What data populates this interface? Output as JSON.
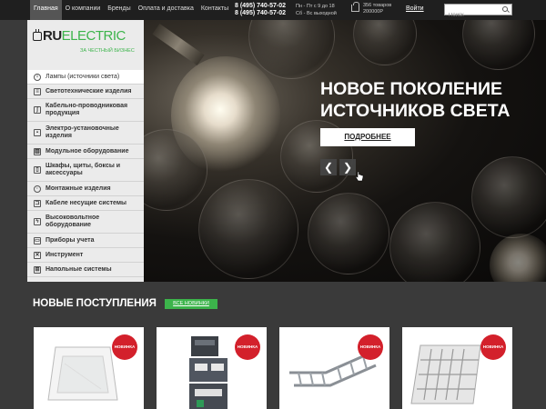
{
  "topbar": {
    "nav": [
      "Главная",
      "О компании",
      "Бренды",
      "Оплата и доставка",
      "Контакты"
    ],
    "phones": [
      "8 (495) 740-57-02",
      "8 (495) 740-57-02"
    ],
    "hours": [
      "Пн - Пт с 9 до 18",
      "Сб - Вс выходной"
    ],
    "cart": [
      "356 товаров",
      "200000Р"
    ],
    "login": "Войти",
    "search_placeholder": "Поиск"
  },
  "logo": {
    "ru": "RU",
    "electric": "ELECTRIC",
    "tagline": "ЗА ЧЕСТНЫЙ БИЗНЕС"
  },
  "categories": [
    "Лампы (источники света)",
    "Светотехнические изделия",
    "Кабельно-проводниковая продукция",
    "Электро-установочные изделия",
    "Модульное оборудование",
    "Шкафы, щиты, боксы и аксессуары",
    "Монтажные изделия",
    "Кабеле несущие системы",
    "Высоковольтное оборудование",
    "Приборы учета",
    "Инструмент",
    "Напольные системы"
  ],
  "hero": {
    "title": "НОВОЕ ПОКОЛЕНИЕ ИСТОЧНИКОВ СВЕТА",
    "button": "ПОДРОБНЕЕ",
    "prev": "❮",
    "next": "❯"
  },
  "new_arrivals": {
    "title": "НОВЫЕ ПОСТУПЛЕНИЯ",
    "all_button": "ВСЕ НОВИНКИ",
    "badge": "НОВИНКА"
  },
  "colors": {
    "accent_green": "#3cb44b",
    "badge_red": "#d3202b",
    "topbar": "#1f1f1f"
  }
}
